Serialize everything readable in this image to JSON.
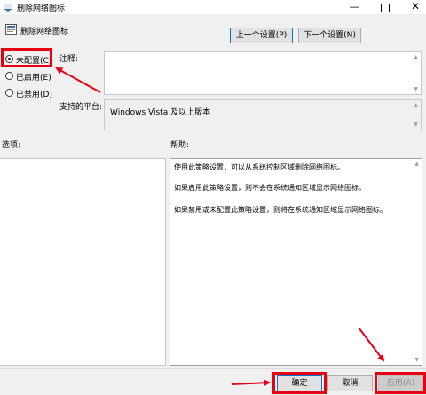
{
  "window": {
    "title": "删除网络图标"
  },
  "header": {
    "policy_name": "删除网络图标"
  },
  "nav": {
    "prev_label": "上一个设置(P)",
    "next_label": "下一个设置(N)"
  },
  "state": {
    "options": [
      {
        "label": "未配置(C)",
        "checked": true
      },
      {
        "label": "已启用(E)",
        "checked": false
      },
      {
        "label": "已禁用(D)",
        "checked": false
      }
    ]
  },
  "comment": {
    "label": "注释:",
    "value": ""
  },
  "platform": {
    "label": "支持的平台:",
    "value": "Windows Vista 及以上版本"
  },
  "options_panel": {
    "label": "选项:"
  },
  "help": {
    "label": "帮助:",
    "paragraphs": [
      "使用此策略设置，可以从系统控制区域删除网络图标。",
      "如果启用此策略设置，则不会在系统通知区域显示网络图标。",
      "如果禁用或未配置此策略设置，则将在系统通知区域显示网络图标。"
    ]
  },
  "footer": {
    "ok_label": "确定",
    "cancel_label": "取消",
    "apply_label": "应用(A)"
  },
  "colors": {
    "highlight": "#e60012",
    "accent": "#0078d7"
  }
}
